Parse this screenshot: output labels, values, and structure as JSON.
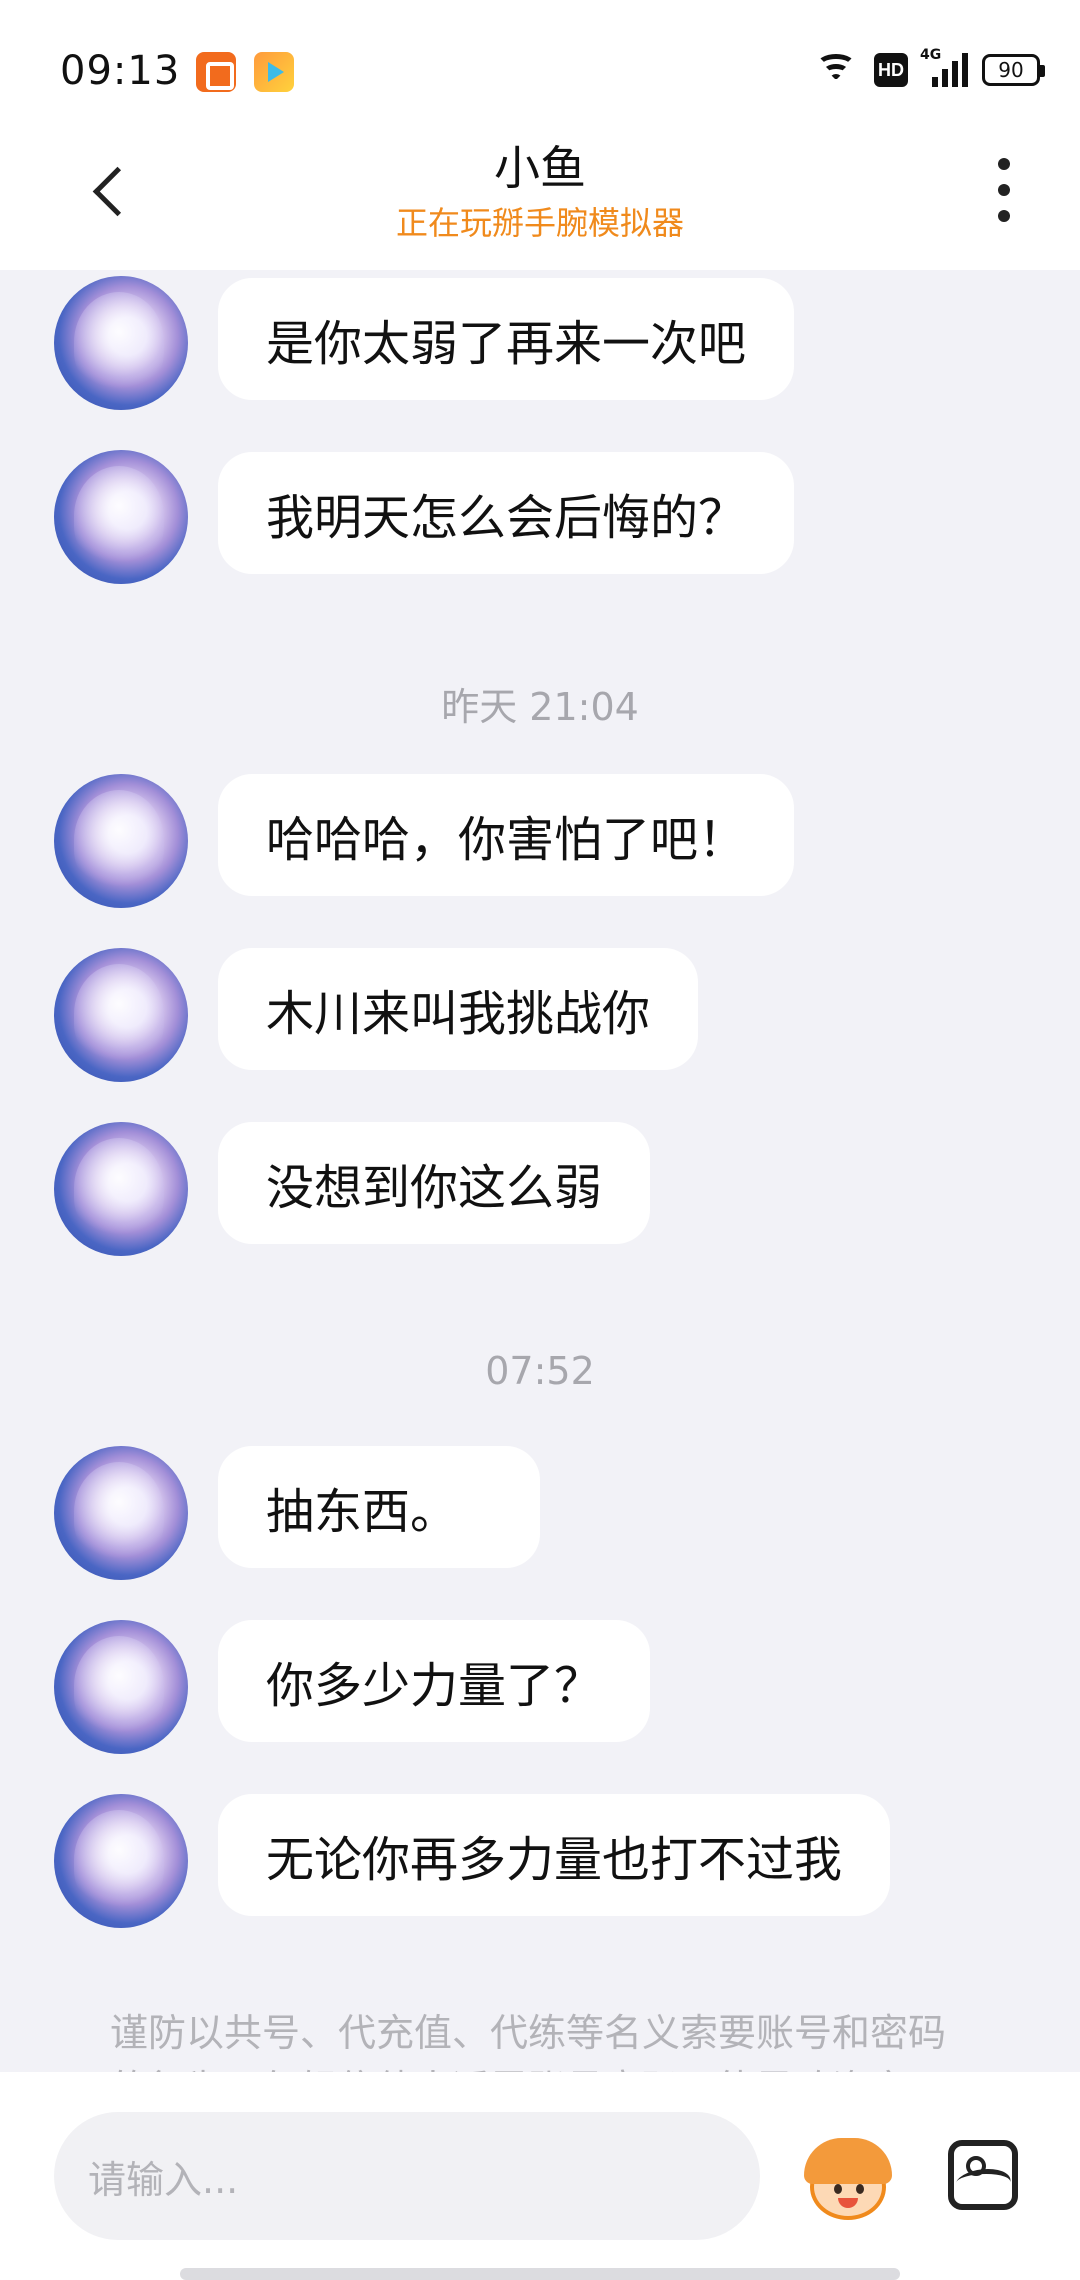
{
  "status_bar": {
    "time": "09:13",
    "battery": "90",
    "network": "4G",
    "hd": "HD"
  },
  "header": {
    "title": "小鱼",
    "subtitle": "正在玩掰手腕模拟器"
  },
  "messages": [
    {
      "text": "是你太弱了再来一次吧"
    },
    {
      "text": "我明天怎么会后悔的？"
    },
    {
      "text": "哈哈哈，你害怕了吧！"
    },
    {
      "text": "木川来叫我挑战你"
    },
    {
      "text": "没想到你这么弱"
    },
    {
      "text": " 抽东西。"
    },
    {
      "text": "你多少力量了？"
    },
    {
      "text": "无论你再多力量也打不过我"
    }
  ],
  "timestamps": [
    "昨天 21:04",
    "07:52"
  ],
  "notice": "谨防以共号、代充值、代练等名义索要账号和密码的行为，勿轻信他人透露账号密码可能导致资产",
  "input": {
    "placeholder": "请输入..."
  },
  "colors": {
    "subtitle": "#f08a1c",
    "background": "#f2f2f7"
  }
}
